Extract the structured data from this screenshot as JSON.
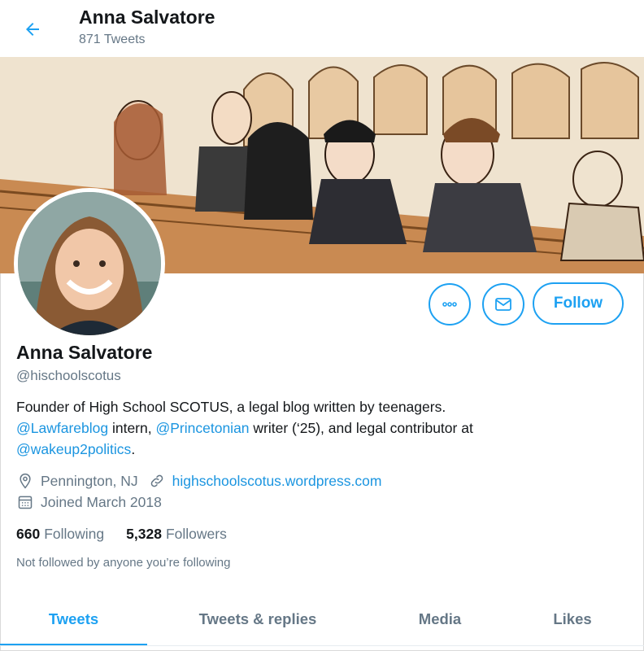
{
  "header": {
    "name": "Anna Salvatore",
    "tweet_count": "871 Tweets",
    "back_icon": "arrow-left-icon"
  },
  "profile": {
    "name": "Anna Salvatore",
    "handle": "@hischoolscotus",
    "bio": {
      "line1": "Founder of High School SCOTUS, a legal blog written by teenagers.",
      "mention1": "@Lawfareblog",
      "text2": " intern, ",
      "mention2": "@Princetonian",
      "text3": " writer (‘25), and legal contributor at",
      "mention3": "@wakeup2politics",
      "text4": "."
    },
    "location": "Pennington, NJ",
    "website": "highschoolscotus.wordpress.com",
    "joined": "Joined March 2018",
    "following_count": "660",
    "following_label": "Following",
    "followers_count": "5,328",
    "followers_label": "Followers",
    "not_followed": "Not followed by anyone you’re following"
  },
  "actions": {
    "more_icon": "more-dots-icon",
    "message_icon": "envelope-icon",
    "follow_label": "Follow"
  },
  "tabs": [
    {
      "label": "Tweets",
      "active": true
    },
    {
      "label": "Tweets & replies",
      "active": false
    },
    {
      "label": "Media",
      "active": false
    },
    {
      "label": "Likes",
      "active": false
    }
  ],
  "colors": {
    "accent": "#1da1f2",
    "link": "#1b95e0",
    "secondary_text": "#657786",
    "primary_text": "#14171a"
  }
}
